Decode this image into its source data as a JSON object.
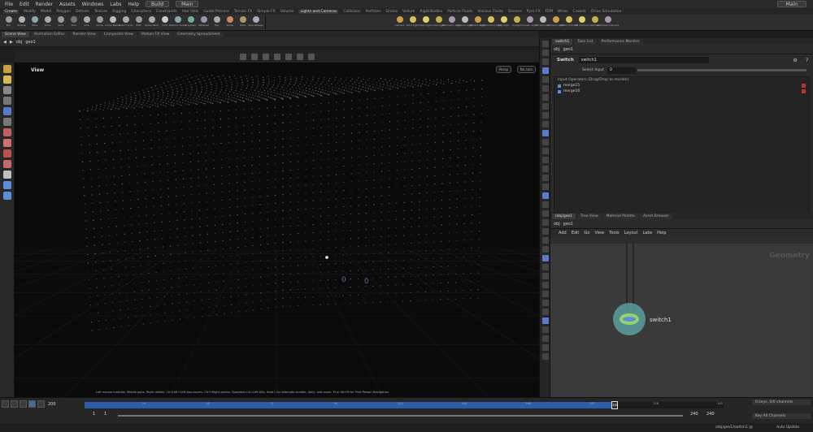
{
  "menubar": {
    "items": [
      "File",
      "Edit",
      "Render",
      "Assets",
      "Windows",
      "Labs",
      "Help"
    ],
    "desktop": "Build",
    "desktop2": "Main",
    "right_label": "Main"
  },
  "shelf_tabs": [
    "Create",
    "Modify",
    "Model",
    "Polygon",
    "Deform",
    "Texture",
    "Rigging",
    "Characters",
    "Constraints",
    "Hair Utils",
    "Guide Process",
    "Terrain FX",
    "Simple FX",
    "Volume",
    "Lights and Cameras",
    "Collisions",
    "Particles",
    "Grains",
    "Vellum",
    "Rigid Bodies",
    "Particle Fluids",
    "Viscous Fluids",
    "Oceans",
    "Pyro FX",
    "FEM",
    "Wires",
    "Crowds",
    "Drive Simulation"
  ],
  "shelf_tools_left": [
    "Box",
    "Sphere",
    "Tube",
    "Torus",
    "Grid",
    "Null",
    "Line",
    "Circle",
    "Curve Bezier",
    "Draw Curve",
    "Path",
    "Spray Paint",
    "Font",
    "Platonic Solids",
    "L-System",
    "Metaball",
    "File",
    "Spiral",
    "Helix",
    "Spaceshape"
  ],
  "shelf_tools_right": [
    "Camera",
    "Point Light",
    "Spot Light",
    "Area Light",
    "Geometry Light",
    "Volume Light",
    "Distant Light",
    "Environment Light",
    "Sky Light",
    "GI Light",
    "Caustic Light",
    "Portal Light",
    "Ambient Light",
    "Stereo Camera",
    "VR Camera",
    "Switcher",
    "Gamepad Camera"
  ],
  "viewport_tabs": [
    "Scene View",
    "Animation Editor",
    "Render View",
    "Composite View",
    "Motion FX View",
    "Geometry Spreadsheet"
  ],
  "viewport_path": [
    "obj",
    "geo1"
  ],
  "viewport": {
    "label": "View",
    "persp_button": "Persp",
    "cam_button": "No cam",
    "hint": "Left mouse tumbles. Middle pans. Right dollies. Ctrl+Alt+Left box-zooms. Ctrl+Right zooms. Spacebar-Ctrl-Left tilts. Hold L for alternate tumble, dolly, and zoom. M or Alt+M for First Person Navigation."
  },
  "param_tabs": [
    "switch1",
    "Take List",
    "Performance Monitor"
  ],
  "param_path": [
    "obj",
    "geo1"
  ],
  "params": {
    "node_type": "Switch",
    "node_name": "switch1",
    "select_input_label": "Select Input",
    "select_input_value": "0",
    "inputs_header": "Input Operators (Drag/Drop to reorder)",
    "inputs": [
      "merge15",
      "merge16"
    ]
  },
  "network_tabs": [
    "/obj/geo1",
    "Tree View",
    "Material Palette",
    "Asset Browser"
  ],
  "network_path": [
    "obj",
    "geo1"
  ],
  "network_menu": [
    "Add",
    "Edit",
    "Go",
    "View",
    "Tools",
    "Layout",
    "Labs",
    "Help"
  ],
  "network": {
    "context_label": "Geometry",
    "node_label": "switch1"
  },
  "timeline": {
    "current_frame": "200",
    "start_frame": "1",
    "start_frame2": "1",
    "end_frame": "240",
    "end_frame2": "240",
    "tick_labels": [
      "24",
      "48",
      "72",
      "96",
      "120",
      "144",
      "168",
      "192",
      "216",
      "240"
    ],
    "progress": 0.83,
    "keys_label": "0 keys, 0/0 channels",
    "key_all_label": "Key All Channels",
    "path_label": "/obj/geo1/switch1 @",
    "auto_update": "Auto Update"
  },
  "colors": {
    "accent": "#2a5ea8",
    "node_body": "#5a8fd6",
    "node_ring": "#9ad26a"
  }
}
